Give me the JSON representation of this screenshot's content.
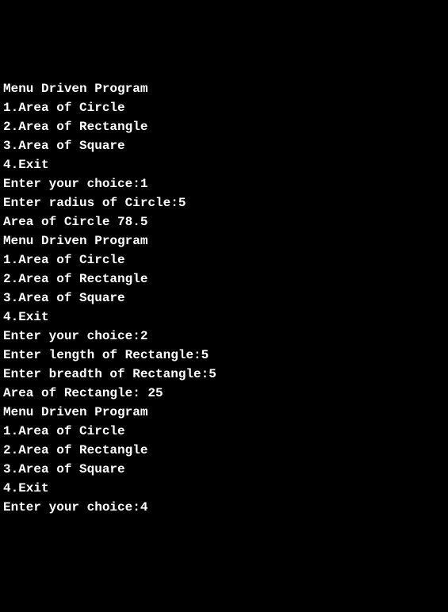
{
  "lines": [
    "Menu Driven Program",
    "1.Area of Circle",
    "2.Area of Rectangle",
    "3.Area of Square",
    "4.Exit",
    "Enter your choice:1",
    "Enter radius of Circle:5",
    "Area of Circle 78.5",
    "Menu Driven Program",
    "1.Area of Circle",
    "2.Area of Rectangle",
    "3.Area of Square",
    "4.Exit",
    "Enter your choice:2",
    "Enter length of Rectangle:5",
    "Enter breadth of Rectangle:5",
    "Area of Rectangle: 25",
    "Menu Driven Program",
    "1.Area of Circle",
    "2.Area of Rectangle",
    "3.Area of Square",
    "4.Exit",
    "Enter your choice:4"
  ]
}
